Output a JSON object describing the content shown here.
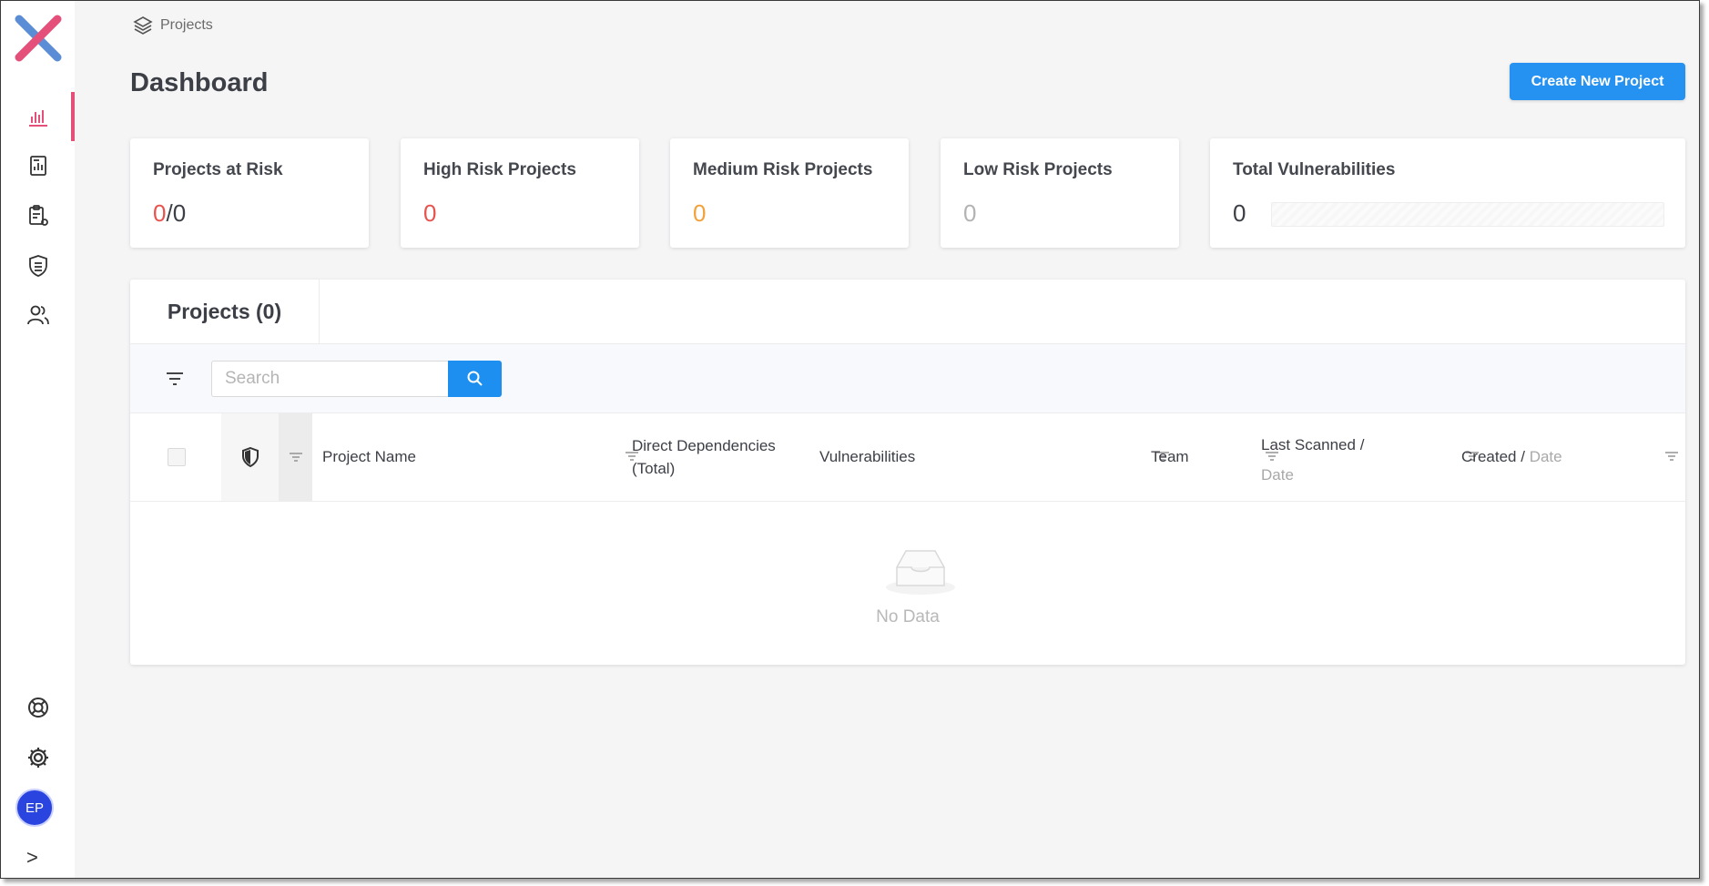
{
  "breadcrumb": {
    "label": "Projects"
  },
  "page": {
    "title": "Dashboard",
    "create_button": "Create New Project"
  },
  "colors": {
    "accent": "#e4507a",
    "primary": "#2592f2",
    "danger": "#e8534e",
    "warning": "#f4a13a",
    "muted": "#b3b3b3"
  },
  "sidebar": {
    "items": [
      {
        "icon": "bar-chart-icon",
        "active": true
      },
      {
        "icon": "report-icon",
        "active": false
      },
      {
        "icon": "clipboard-settings-icon",
        "active": false
      },
      {
        "icon": "shield-icon",
        "active": false
      },
      {
        "icon": "users-icon",
        "active": false
      }
    ],
    "bottom": [
      {
        "icon": "lifebuoy-icon"
      },
      {
        "icon": "gear-icon"
      }
    ],
    "avatar_initials": "EP",
    "expand": ">"
  },
  "cards": {
    "at_risk": {
      "title": "Projects at Risk",
      "value": "0",
      "sep": "/",
      "total": "0"
    },
    "high": {
      "title": "High Risk Projects",
      "value": "0"
    },
    "medium": {
      "title": "Medium Risk Projects",
      "value": "0"
    },
    "low": {
      "title": "Low Risk Projects",
      "value": "0"
    },
    "vulns": {
      "title": "Total Vulnerabilities",
      "value": "0"
    }
  },
  "projects": {
    "tab_label": "Projects (0)",
    "search_placeholder": "Search",
    "columns": {
      "name": "Project Name",
      "deps_line1": "Direct Dependencies",
      "deps_line2": "(Total)",
      "vulns": "Vulnerabilities",
      "team": "Team",
      "scanned_line1": "Last Scanned",
      "scanned_slash": "/",
      "scanned_line2": "Date",
      "created": "Created",
      "created_slash": "/",
      "created_date": "Date"
    },
    "empty_text": "No Data"
  }
}
